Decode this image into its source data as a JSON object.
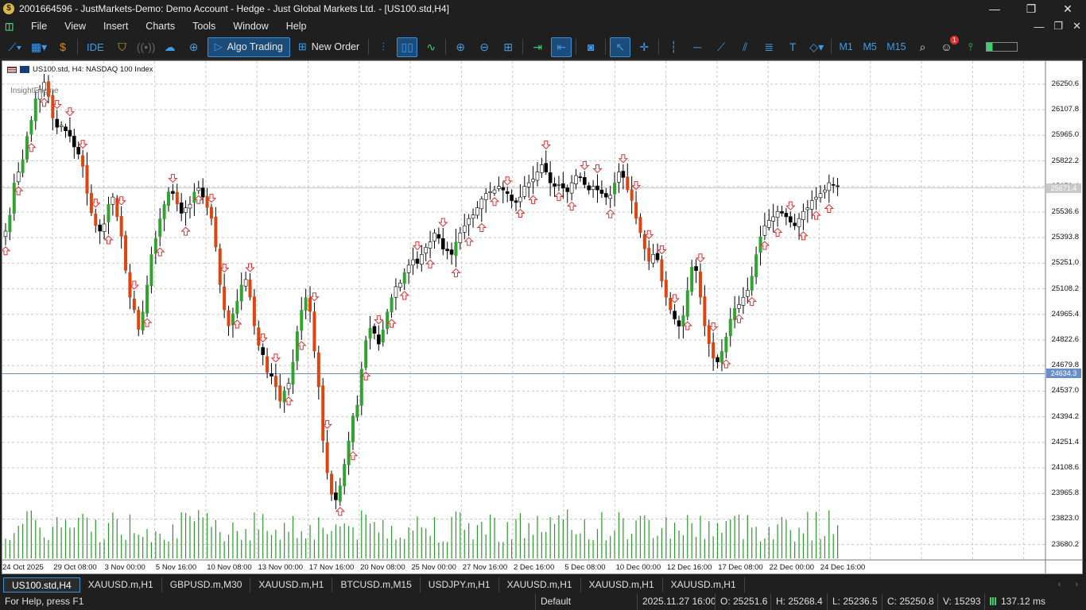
{
  "window": {
    "title": "2001664596 - JustMarkets-Demo: Demo Account - Hedge - Just Global Markets Ltd. - [US100.std,H4]",
    "controls": [
      "—",
      "❐",
      "✕"
    ]
  },
  "menu": {
    "items": [
      "File",
      "View",
      "Insert",
      "Charts",
      "Tools",
      "Window",
      "Help"
    ],
    "right_controls": [
      "—",
      "❐",
      "✕"
    ]
  },
  "toolbar": {
    "ide_label": "IDE",
    "algo_trading_label": "Algo Trading",
    "new_order_label": "New Order",
    "timeframes": [
      "M1",
      "M5",
      "M15"
    ],
    "notification_count": "1"
  },
  "chart": {
    "symbol_header": "US100.std, H4:  NASDAQ 100 Index",
    "indicator_label": "InsightEngine",
    "current_price": "25671.4",
    "line_price": "24634.3",
    "colors": {
      "bull_body": "#2fa52f",
      "bear_body": "#e0440e",
      "wick": "#000000",
      "signal_arrow": "#e03030",
      "volume": "#2a9a2a",
      "grid": "#c8c8c8",
      "hline": "#6a8fc8"
    }
  },
  "chart_data": {
    "type": "candlestick",
    "title": "US100.std, H4: NASDAQ 100 Index",
    "price_ticks": [
      "26250.6",
      "26107.8",
      "25965.0",
      "25822.2",
      "25679.4",
      "25536.6",
      "25393.8",
      "25251.0",
      "25108.2",
      "24965.4",
      "24822.6",
      "24679.8",
      "24537.0",
      "24394.2",
      "24251.4",
      "24108.6",
      "23965.8",
      "23823.0",
      "23680.2"
    ],
    "time_ticks": [
      "24 Oct 2025",
      "29 Oct 08:00",
      "3 Nov 00:00",
      "5 Nov 16:00",
      "10 Nov 08:00",
      "13 Nov 00:00",
      "17 Nov 16:00",
      "20 Nov 08:00",
      "25 Nov 00:00",
      "27 Nov 16:00",
      "2 Dec 16:00",
      "5 Dec 08:00",
      "10 Dec 00:00",
      "12 Dec 16:00",
      "17 Dec 08:00",
      "22 Dec 00:00",
      "24 Dec 16:00"
    ],
    "ylim": [
      23630,
      26290
    ],
    "close_path": [
      25430,
      25520,
      25700,
      25760,
      25830,
      25960,
      26050,
      26170,
      26220,
      26260,
      26180,
      26060,
      26010,
      26020,
      25990,
      25960,
      25900,
      25860,
      25790,
      25640,
      25530,
      25460,
      25430,
      25470,
      25580,
      25620,
      25510,
      25400,
      25210,
      25060,
      24990,
      24880,
      24980,
      25130,
      25300,
      25390,
      25500,
      25580,
      25650,
      25640,
      25580,
      25530,
      25560,
      25580,
      25650,
      25670,
      25620,
      25560,
      25500,
      25340,
      25130,
      24990,
      24900,
      24970,
      25040,
      25130,
      25160,
      25060,
      24900,
      24790,
      24740,
      24640,
      24620,
      24560,
      24480,
      24540,
      24580,
      24700,
      24870,
      24990,
      25060,
      24980,
      24760,
      24560,
      24260,
      24080,
      23960,
      23930,
      24010,
      24130,
      24260,
      24400,
      24460,
      24660,
      24820,
      24890,
      24860,
      24800,
      24880,
      24980,
      25060,
      25120,
      25140,
      25200,
      25240,
      25270,
      25250,
      25300,
      25340,
      25370,
      25420,
      25390,
      25330,
      25320,
      25300,
      25370,
      25420,
      25460,
      25500,
      25520,
      25560,
      25610,
      25640,
      25650,
      25660,
      25680,
      25660,
      25640,
      25600,
      25590,
      25620,
      25680,
      25700,
      25720,
      25760,
      25800,
      25760,
      25700,
      25680,
      25690,
      25670,
      25650,
      25700,
      25740,
      25730,
      25690,
      25660,
      25680,
      25660,
      25640,
      25620,
      25630,
      25700,
      25760,
      25730,
      25660,
      25600,
      25500,
      25420,
      25330,
      25260,
      25300,
      25270,
      25150,
      25060,
      24990,
      24940,
      24900,
      24960,
      25100,
      25230,
      25210,
      25060,
      24900,
      24800,
      24720,
      24700,
      24760,
      24840,
      24940,
      25000,
      25020,
      25060,
      25100,
      25180,
      25300,
      25400,
      25460,
      25490,
      25510,
      25540,
      25530,
      25510,
      25480,
      25460,
      25500,
      25540,
      25560,
      25600,
      25620,
      25640,
      25660,
      25700,
      25690,
      25680
    ]
  },
  "tabs": [
    "US100.std,H4",
    "XAUUSD.m,H1",
    "GBPUSD.m,M30",
    "XAUUSD.m,H1",
    "BTCUSD.m,M15",
    "USDJPY.m,H1",
    "XAUUSD.m,H1",
    "XAUUSD.m,H1",
    "XAUUSD.m,H1"
  ],
  "status": {
    "help": "For Help, press F1",
    "profile": "Default",
    "datetime": "2025.11.27 16:00",
    "open": "O: 25251.6",
    "high": "H: 25268.4",
    "low": "L: 25236.5",
    "close": "C: 25250.8",
    "volume": "V: 15293",
    "ping": "137.12 ms"
  }
}
